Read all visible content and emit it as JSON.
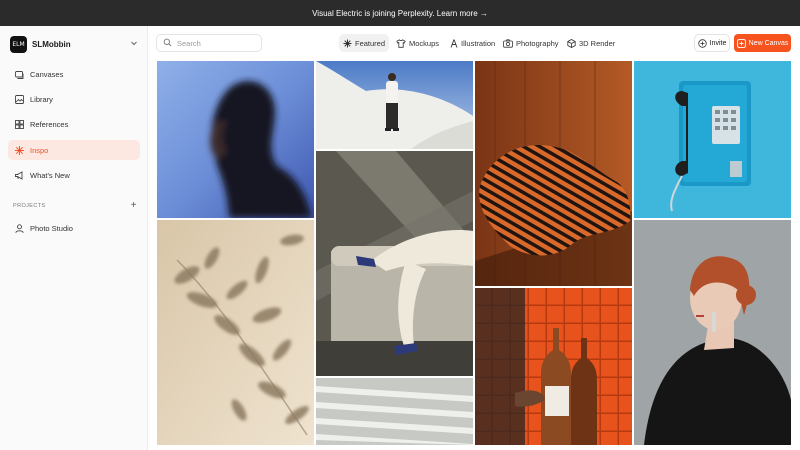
{
  "banner": {
    "text": "Visual Electric is joining Perplexity. Learn more →"
  },
  "workspace": {
    "logo_text": "ELM",
    "name": "SLMobbin"
  },
  "sidebar": {
    "nav": [
      {
        "label": "Canvases",
        "icon": "canvases-icon"
      },
      {
        "label": "Library",
        "icon": "library-icon"
      },
      {
        "label": "References",
        "icon": "references-icon"
      },
      {
        "label": "Inspo",
        "icon": "inspo-icon",
        "active": true
      },
      {
        "label": "What's New",
        "icon": "megaphone-icon"
      }
    ],
    "projects_heading": "PROJECTS",
    "projects": [
      {
        "label": "Photo Studio",
        "icon": "person-icon"
      }
    ]
  },
  "search": {
    "placeholder": "Search"
  },
  "tabs": [
    {
      "label": "Featured",
      "icon": "sparkle-icon",
      "active": true
    },
    {
      "label": "Mockups",
      "icon": "tshirt-icon"
    },
    {
      "label": "Illustration",
      "icon": "pen-nib-icon"
    },
    {
      "label": "Photography",
      "icon": "camera-icon"
    },
    {
      "label": "3D Render",
      "icon": "cube-icon"
    }
  ],
  "actions": {
    "invite": "Invite",
    "new_canvas": "New Canvas"
  },
  "colors": {
    "accent": "#f6531f",
    "active_bg": "#fde7e1",
    "banner_bg": "#2b2b2b"
  },
  "gallery": [
    "blurred-portrait-woman-blue",
    "man-standing-white-wall-sky",
    "striped-fabric-wood-room",
    "blue-payphone",
    "leaf-shadow-beige-wall",
    "legs-on-sofa-sunlight",
    "red-haired-woman-profile",
    "wine-bottles-red-tiles",
    "light-shadow-stripes"
  ]
}
